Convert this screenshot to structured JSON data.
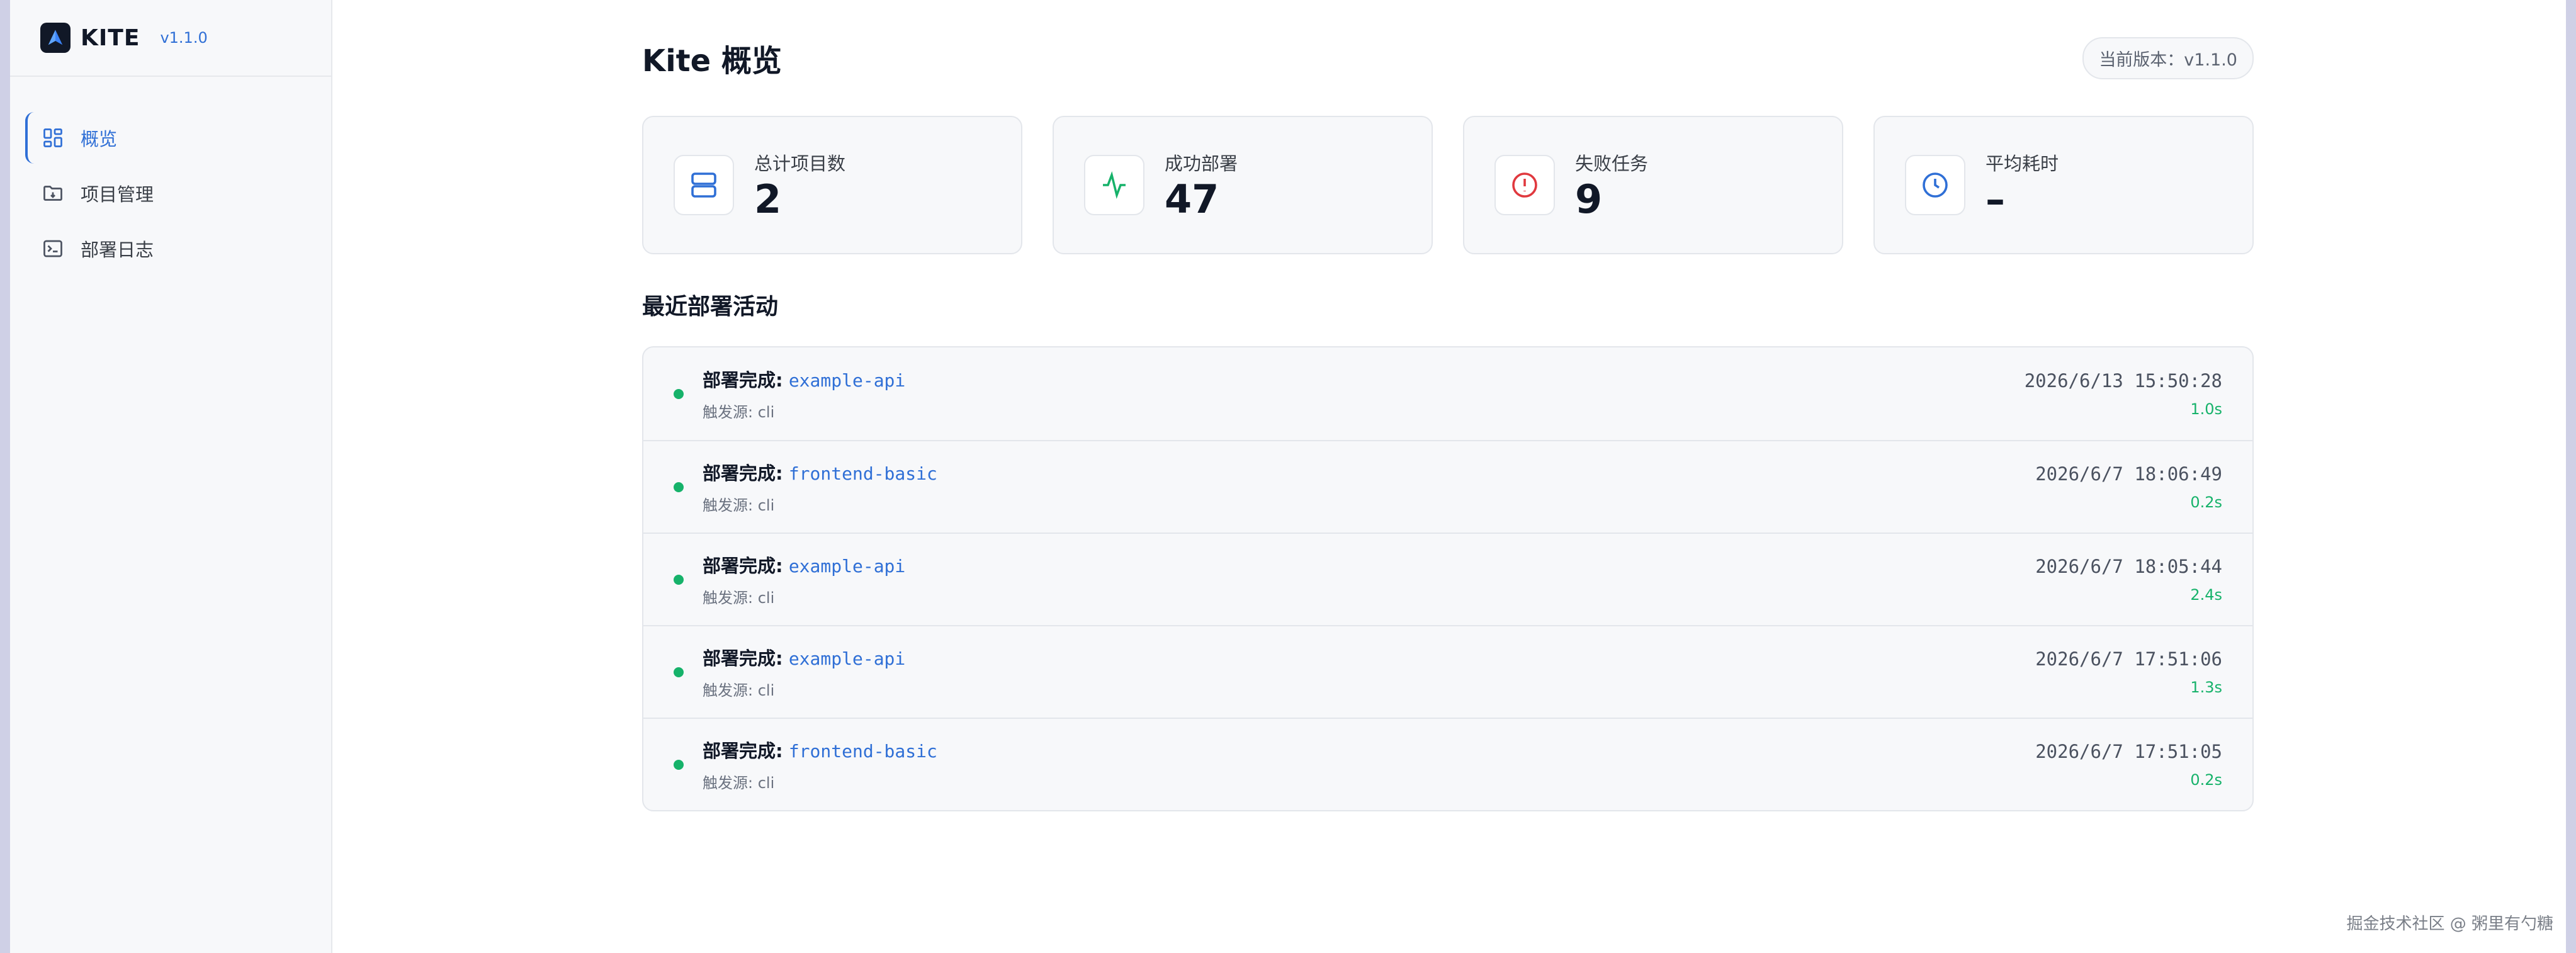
{
  "brand": {
    "name": "KITE",
    "version": "v1.1.0"
  },
  "sidebar": {
    "items": [
      {
        "label": "概览",
        "icon": "dashboard-icon",
        "active": true
      },
      {
        "label": "项目管理",
        "icon": "folder-icon",
        "active": false
      },
      {
        "label": "部署日志",
        "icon": "terminal-icon",
        "active": false
      }
    ]
  },
  "header": {
    "title": "Kite 概览",
    "version_label": "当前版本：v1.1.0"
  },
  "stats": [
    {
      "label": "总计项目数",
      "value": "2",
      "icon": "server-icon",
      "color": "#2f6fd6"
    },
    {
      "label": "成功部署",
      "value": "47",
      "icon": "activity-icon",
      "color": "#16b26a"
    },
    {
      "label": "失败任务",
      "value": "9",
      "icon": "alert-icon",
      "color": "#e0383e"
    },
    {
      "label": "平均耗时",
      "value": "–",
      "icon": "clock-icon",
      "color": "#2f6fd6"
    }
  ],
  "activity": {
    "title": "最近部署活动",
    "items": [
      {
        "label": "部署完成:",
        "project": "example-api",
        "source": "触发源: cli",
        "time": "2026/6/13 15:50:28",
        "duration": "1.0s"
      },
      {
        "label": "部署完成:",
        "project": "frontend-basic",
        "source": "触发源: cli",
        "time": "2026/6/7 18:06:49",
        "duration": "0.2s"
      },
      {
        "label": "部署完成:",
        "project": "example-api",
        "source": "触发源: cli",
        "time": "2026/6/7 18:05:44",
        "duration": "2.4s"
      },
      {
        "label": "部署完成:",
        "project": "example-api",
        "source": "触发源: cli",
        "time": "2026/6/7 17:51:06",
        "duration": "1.3s"
      },
      {
        "label": "部署完成:",
        "project": "frontend-basic",
        "source": "触发源: cli",
        "time": "2026/6/7 17:51:05",
        "duration": "0.2s"
      }
    ]
  },
  "watermark": "掘金技术社区 @ 粥里有勺糖",
  "colors": {
    "accent": "#2f6fd6",
    "success": "#16b26a",
    "danger": "#e0383e"
  }
}
